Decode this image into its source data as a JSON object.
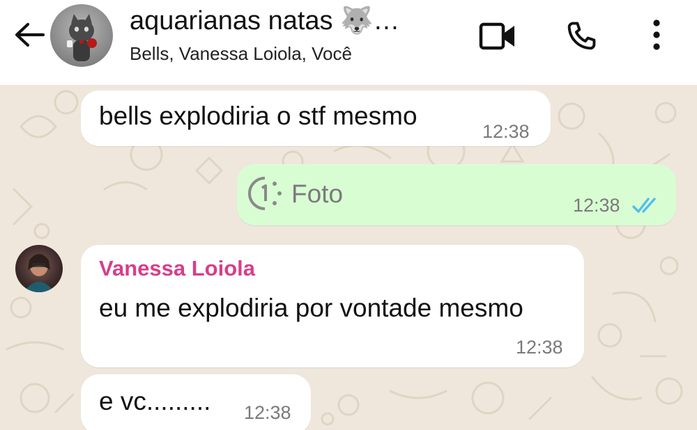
{
  "header": {
    "title": "aquarianas natas 🐺…",
    "subtitle": "Bells, Vanessa Loiola, Você"
  },
  "messages": [
    {
      "text": "bells explodiria o stf mesmo",
      "time": "12:38"
    },
    {
      "label": "Foto",
      "time": "12:38"
    },
    {
      "sender": "Vanessa Loiola",
      "text": "eu me explodiria por vontade mesmo",
      "time": "12:38"
    },
    {
      "text": "e vc.........",
      "time": "12:38"
    }
  ],
  "colors": {
    "incoming_bubble": "#ffffff",
    "outgoing_bubble": "#d9fdd3",
    "sender_name": "#d63e8a",
    "read_ticks": "#53bdeb",
    "wallpaper": "#efe7dc"
  },
  "icons": [
    "back-arrow-icon",
    "video-call-icon",
    "phone-call-icon",
    "more-options-icon",
    "pending-upload-icon",
    "double-check-icon"
  ]
}
